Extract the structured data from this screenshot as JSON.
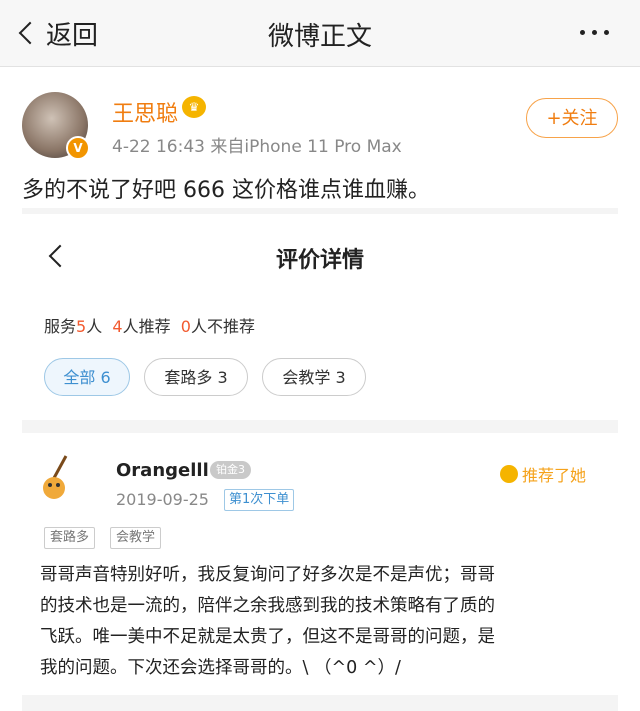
{
  "header": {
    "back_label": "返回",
    "title": "微博正文",
    "more_icon": "more-dots-icon"
  },
  "post": {
    "username": "王思聪",
    "time": "4-22 16:43",
    "source": "来自iPhone 11 Pro Max",
    "follow_label": "+关注",
    "text": "多的不说了好吧 666 这价格谁点谁血赚。",
    "verified_badge": "V"
  },
  "embedded": {
    "title": "评价详情",
    "stats": {
      "service_prefix": "服务",
      "service_count": "5",
      "service_unit": "人",
      "recommend_count": "4",
      "recommend_text": "人推荐",
      "not_recommend_count": "0",
      "not_recommend_text": "人不推荐"
    },
    "filters": [
      {
        "label": "全部 6",
        "active": true
      },
      {
        "label": "套路多 3",
        "active": false
      },
      {
        "label": "会教学 3",
        "active": false
      }
    ],
    "review": {
      "username": "Orangelll",
      "level": "铂金3",
      "recommend_label": "推荐了她",
      "date": "2019-09-25",
      "order_tag": "第1次下单",
      "tags": [
        "套路多",
        "会教学"
      ],
      "lines": [
        "哥哥声音特别好听，我反复询问了好多次是不是声优；哥哥",
        "的技术也是一流的，陪伴之余我感到我的技术策略有了质的",
        "飞跃。唯一美中不足就是太贵了，但这不是哥哥的问题，是",
        "我的问题。下次还会选择哥哥的。\\ （^0 ^）/"
      ]
    }
  },
  "colors": {
    "accent_orange": "#f07d10",
    "chip_blue": "#3d8fd0",
    "stat_red": "#f25a2f"
  }
}
